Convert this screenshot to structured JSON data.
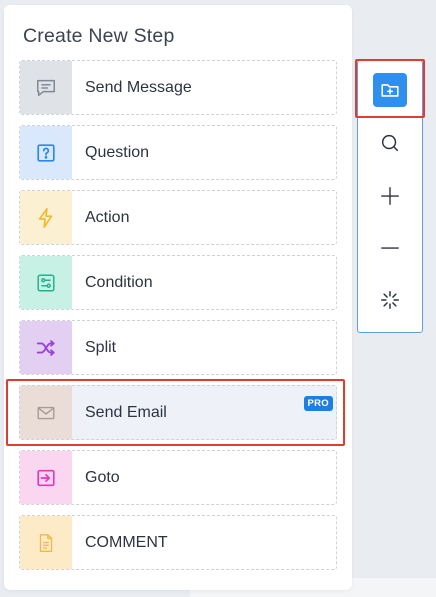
{
  "panel": {
    "title": "Create New Step",
    "steps": [
      {
        "label": "Send Message",
        "icon": "message-icon",
        "bg": "#dfe3e8",
        "color": "#7f8894"
      },
      {
        "label": "Question",
        "icon": "question-icon",
        "bg": "#d9e9fb",
        "color": "#2f86ea"
      },
      {
        "label": "Action",
        "icon": "lightning-icon",
        "bg": "#fcf0d2",
        "color": "#f2b630"
      },
      {
        "label": "Condition",
        "icon": "condition-icon",
        "bg": "#c7f1e5",
        "color": "#23b08c"
      },
      {
        "label": "Split",
        "icon": "shuffle-icon",
        "bg": "#e2cff2",
        "color": "#9a45d8"
      },
      {
        "label": "Send Email",
        "icon": "mail-icon",
        "bg": "#eaddd8",
        "color": "#a99893",
        "badge": "PRO"
      },
      {
        "label": "Goto",
        "icon": "goto-icon",
        "bg": "#fbd6f1",
        "color": "#e03ab7"
      },
      {
        "label": "COMMENT",
        "icon": "document-icon",
        "bg": "#fdebc7",
        "color": "#f2b94a"
      }
    ]
  },
  "toolbar": {
    "items": [
      {
        "name": "add-folder-icon"
      },
      {
        "name": "search-icon"
      },
      {
        "name": "zoom-in-icon"
      },
      {
        "name": "zoom-out-icon"
      },
      {
        "name": "auto-arrange-icon"
      }
    ],
    "accent": "#2f8fee"
  }
}
